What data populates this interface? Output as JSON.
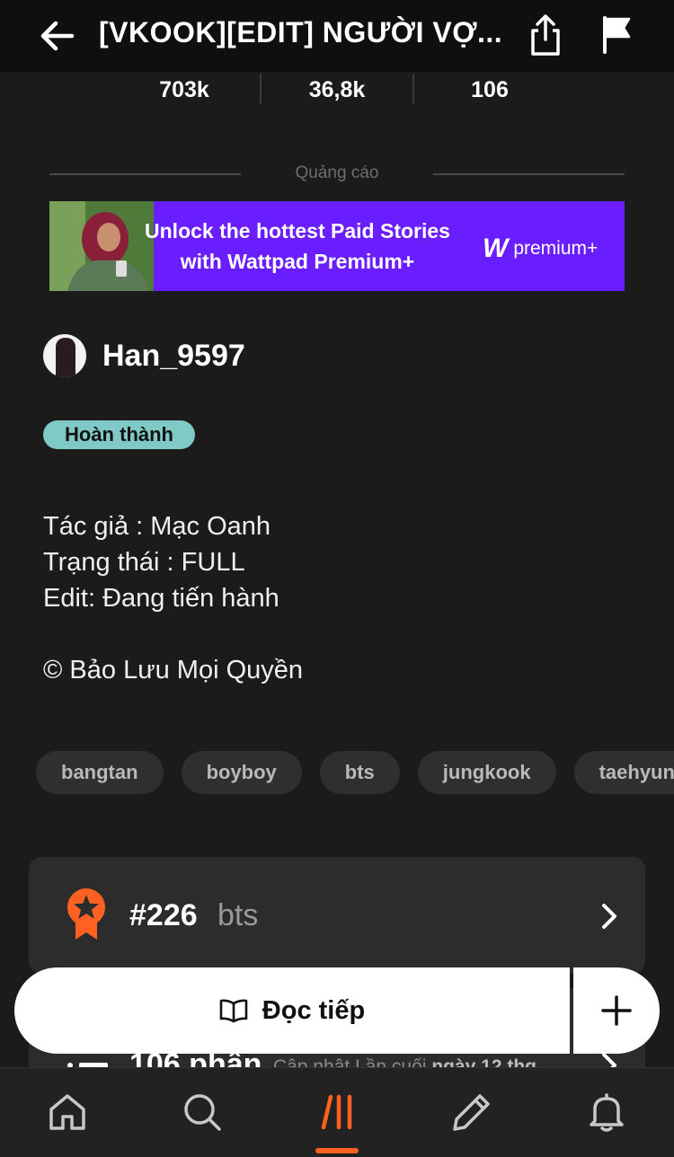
{
  "header": {
    "title": "[VKOOK][EDIT] NGƯỜI VỢ..."
  },
  "stats": {
    "reads": "703k",
    "votes": "36,8k",
    "parts": "106"
  },
  "ad": {
    "label": "Quảng cáo",
    "line1": "Unlock the hottest Paid Stories",
    "line2": "with Wattpad Premium+",
    "logo_mark": "W",
    "logo_text": "premium+"
  },
  "author": {
    "name": "Han_9597"
  },
  "status_badge": "Hoàn thành",
  "description": {
    "lines": [
      "Tác giả : Mạc Oanh",
      "Trạng thái : FULL",
      "Edit: Đang tiến hành",
      "© Bảo Lưu Mọi Quyền"
    ]
  },
  "tags": [
    "bangtan",
    "boyboy",
    "bts",
    "jungkook",
    "taehyung"
  ],
  "ranking": {
    "rank": "#226",
    "tag": "bts"
  },
  "parts": {
    "title": "106 phần",
    "updated_prefix": "Cập nhật Lần cuối",
    "updated_date": "ngày 12 thg"
  },
  "read_button": {
    "label": "Đọc tiếp"
  },
  "colors": {
    "accent": "#ff6122",
    "badge": "#7fcac6",
    "ad_bg": "#6a1dff"
  },
  "nav": {
    "items": [
      "home-icon",
      "search-icon",
      "library-icon",
      "write-icon",
      "notifications-icon"
    ],
    "active": "library-icon"
  }
}
